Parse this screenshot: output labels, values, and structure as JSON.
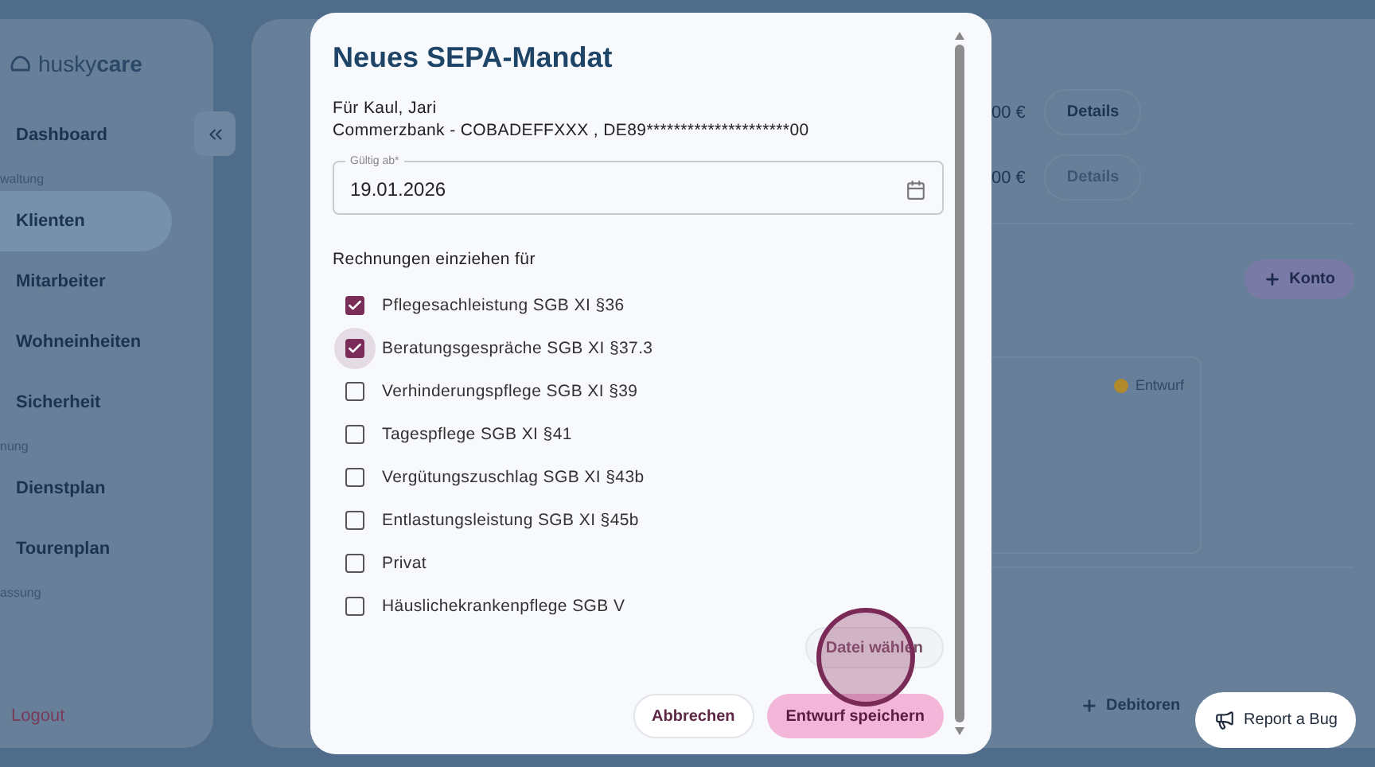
{
  "sidebar": {
    "logo": {
      "prefix": "husky",
      "suffix": "care"
    },
    "items": [
      {
        "kind": "item",
        "label": "Dashboard",
        "selected": false
      },
      {
        "kind": "section",
        "label": "waltung"
      },
      {
        "kind": "item",
        "label": "Klienten",
        "selected": true
      },
      {
        "kind": "item",
        "label": "Mitarbeiter",
        "selected": false
      },
      {
        "kind": "item",
        "label": "Wohneinheiten",
        "selected": false
      },
      {
        "kind": "item",
        "label": "Sicherheit",
        "selected": false
      },
      {
        "kind": "section",
        "label": "nung"
      },
      {
        "kind": "item",
        "label": "Dienstplan",
        "selected": false
      },
      {
        "kind": "item",
        "label": "Tourenplan",
        "selected": false
      },
      {
        "kind": "section",
        "label": "assung"
      }
    ],
    "logout": "Logout"
  },
  "main": {
    "rows": [
      {
        "amount": "00 €",
        "action": "Details",
        "disabled": false
      },
      {
        "amount": "00 €",
        "action": "Details",
        "disabled": true
      }
    ],
    "add_account": "Konto",
    "card_status": {
      "label": "Entwurf",
      "color": "#b08a2c"
    },
    "add_debitor": "Debitoren"
  },
  "dialog": {
    "title": "Neues SEPA-Mandat",
    "recipient": "Für Kaul, Jari",
    "bank": "Commerzbank - COBADEFFXXX , DE89*********************00",
    "date_field": {
      "label": "Gültig ab*",
      "value": "19.01.2026"
    },
    "section": "Rechnungen einziehen für",
    "options": [
      {
        "label": "Pflegesachleistung SGB XI §36",
        "checked": true,
        "focused": false
      },
      {
        "label": "Beratungsgespräche SGB XI §37.3",
        "checked": true,
        "focused": true
      },
      {
        "label": "Verhinderungspflege SGB XI §39",
        "checked": false,
        "focused": false
      },
      {
        "label": "Tagespflege SGB XI §41",
        "checked": false,
        "focused": false
      },
      {
        "label": "Vergütungszuschlag SGB XI §43b",
        "checked": false,
        "focused": false
      },
      {
        "label": "Entlastungsleistung SGB XI §45b",
        "checked": false,
        "focused": false
      },
      {
        "label": "Privat",
        "checked": false,
        "focused": false
      },
      {
        "label": "Häuslichekrankenpflege SGB V",
        "checked": false,
        "focused": false
      }
    ],
    "file_button": "Datei wählen",
    "cancel": "Abbrechen",
    "save": "Entwurf speichern"
  },
  "report_button": "Report a Bug"
}
